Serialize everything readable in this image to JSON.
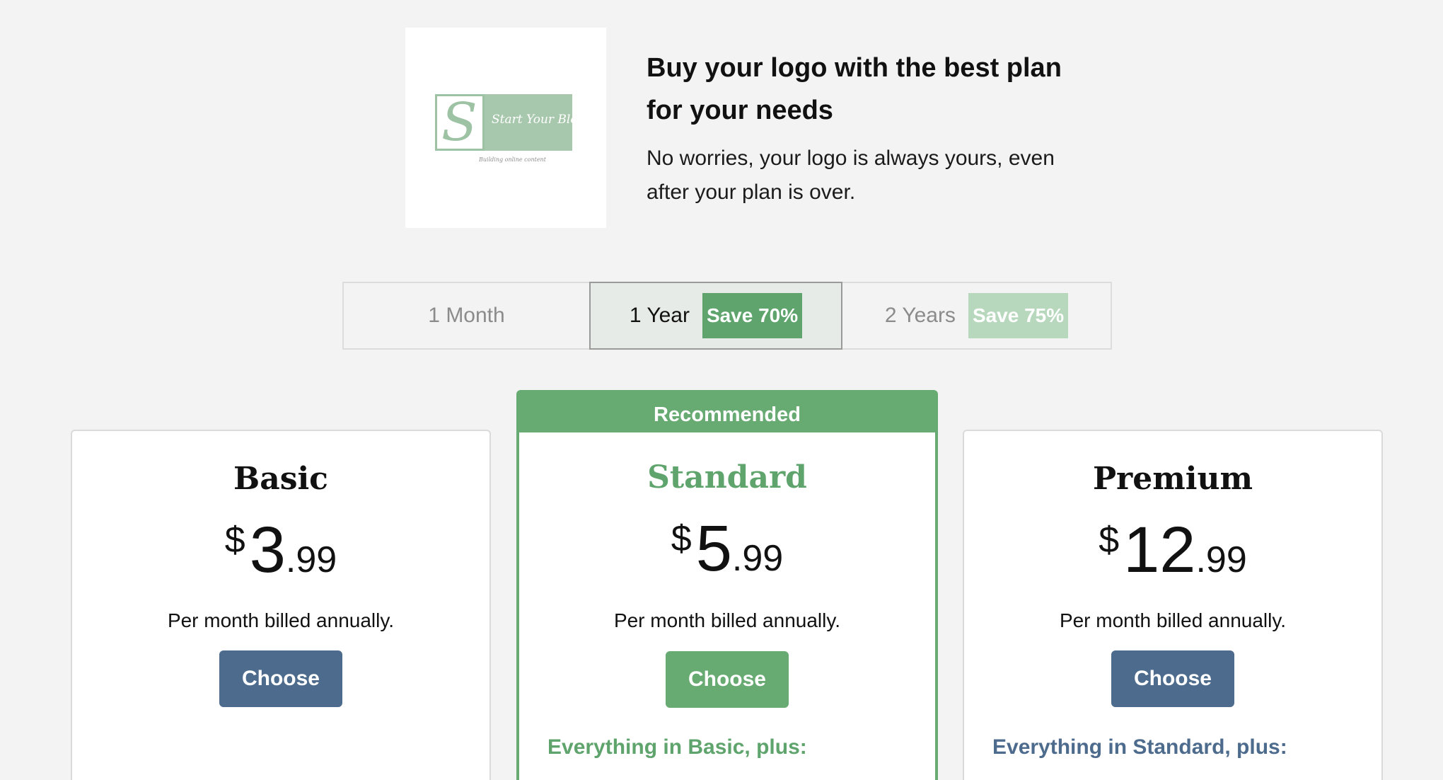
{
  "header": {
    "logo_name": "Start Your Blog",
    "logo_tagline": "Building online content",
    "headline": "Buy your logo with the best plan for your needs",
    "subtext": "No worries, your logo is always yours, even after your plan is over."
  },
  "billing_tabs": [
    {
      "label": "1 Month",
      "badge": "",
      "selected": false
    },
    {
      "label": "1 Year",
      "badge": "Save 70%",
      "selected": true
    },
    {
      "label": "2 Years",
      "badge": "Save 75%",
      "selected": false
    }
  ],
  "plans": [
    {
      "name": "Basic",
      "currency": "$",
      "whole": "3",
      "cents": ".99",
      "billing": "Per month billed annually.",
      "cta": "Choose",
      "includes": "",
      "recommended": false
    },
    {
      "name": "Standard",
      "currency": "$",
      "whole": "5",
      "cents": ".99",
      "billing": "Per month billed annually.",
      "cta": "Choose",
      "includes": "Everything in Basic, plus:",
      "recommended": true,
      "recommended_label": "Recommended"
    },
    {
      "name": "Premium",
      "currency": "$",
      "whole": "12",
      "cents": ".99",
      "billing": "Per month billed annually.",
      "cta": "Choose",
      "includes": "Everything in Standard, plus:",
      "recommended": false
    }
  ],
  "colors": {
    "accent_green": "#67ab73",
    "button_blue": "#4d6b8c",
    "badge_light_green": "#b8d8be",
    "background": "#f3f3f3"
  }
}
